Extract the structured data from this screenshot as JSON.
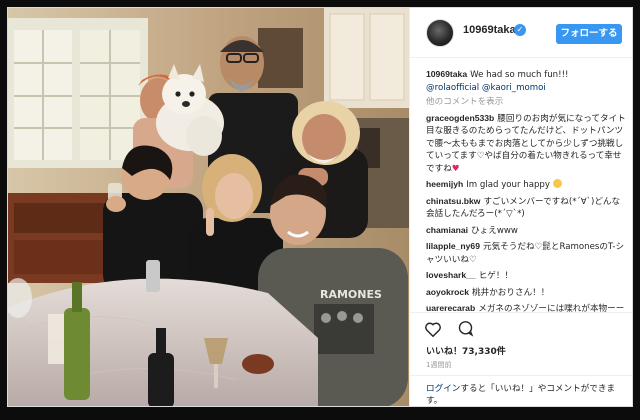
{
  "post": {
    "username": "10969taka",
    "follow_label": "フォローする",
    "caption_user": "10969taka",
    "caption_text": "We had so much fun!!!",
    "caption_mentions": "@rolaofficial @kaori_momoi",
    "load_more": "他のコメントを表示",
    "comments": [
      {
        "user": "graceogden533b",
        "text": "腰回りのお肉が気になってタイト目な服きるのためらってたんだけど、ドットパンツで腰〜太ももまでお肉落としてから少しずつ挑戦していってます♡やば自分の着たい物きれるって幸せですね"
      },
      {
        "user": "heemijyh",
        "text": "Im glad your happy"
      },
      {
        "user": "chinatsu.bkw",
        "text": "すごいメンバーですね(*´∀`)どんな会話したんだろー(*´▽`*)"
      },
      {
        "user": "chamianai",
        "text": "ひょえwww"
      },
      {
        "user": "lilapple_ny69",
        "text": "元気そうだね♡髭とRamonesのT-シャツいいね♡"
      },
      {
        "user": "loveshark__",
        "text": "ヒゲ！！"
      },
      {
        "user": "aoyokrock",
        "text": "桃井かおりさん！！"
      },
      {
        "user": "uarerecarab",
        "text": "メガネのネゾゾーには喋れが本物ーー口"
      }
    ],
    "likes": "いいね！73,330件",
    "time": "1週間前",
    "login_link": "ログイン",
    "login_text": "すると「いいね！」やコメントができます。"
  },
  "icons": {
    "heart": "heart-icon",
    "comment": "comment-icon",
    "verified": "verified-badge-icon"
  },
  "colors": {
    "accent": "#3897f0",
    "link": "#003569",
    "muted": "#999999"
  }
}
